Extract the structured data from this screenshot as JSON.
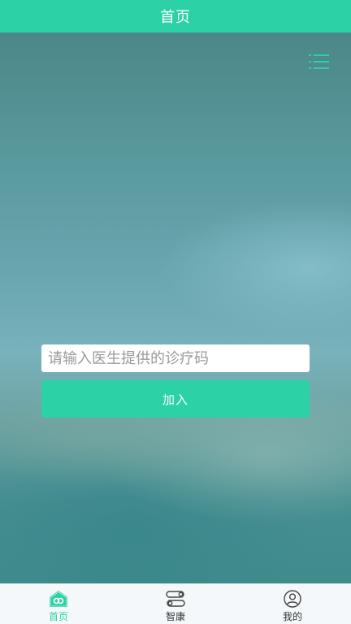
{
  "header": {
    "title": "首页"
  },
  "search": {
    "placeholder": "请输入医生提供的诊疗码",
    "value": ""
  },
  "join_button": {
    "label": "加入"
  },
  "bottom_nav": {
    "items": [
      {
        "label": "首页",
        "icon": "home-icon",
        "active": true
      },
      {
        "label": "智康",
        "icon": "switch-icon",
        "active": false
      },
      {
        "label": "我的",
        "icon": "profile-icon",
        "active": false
      }
    ]
  },
  "colors": {
    "accent": "#2cd1a6",
    "nav_background": "#f4f8fa",
    "inactive_text": "#333333"
  }
}
